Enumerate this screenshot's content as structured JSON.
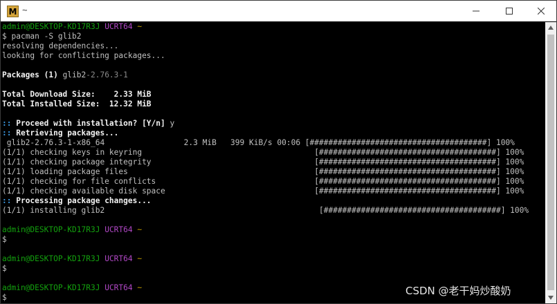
{
  "window": {
    "title": "~",
    "app_icon_letter": "M",
    "controls": [
      "minimize-icon",
      "maximize-icon",
      "close-icon"
    ]
  },
  "prompt": {
    "user_host": "admin@DESKTOP-KD17R3J",
    "env": "UCRT64",
    "dir": "~",
    "symbol": "$"
  },
  "terminal": {
    "cmd": " pacman -S glib2",
    "resolving": "resolving dependencies...",
    "conflicts": "looking for conflicting packages...",
    "packages_label": "Packages (1) ",
    "packages_name": "glib2",
    "packages_version": "-2.76.3-1",
    "download_size": "Total Download Size:    2.33 MiB",
    "installed_size": "Total Installed Size:  12.32 MiB",
    "proceed_marker": "::",
    "proceed_text": " Proceed with installation? [Y/n] ",
    "proceed_answer": "y",
    "retrieving_marker": "::",
    "retrieving_text": " Retrieving packages...",
    "download_line": " glib2-2.76.3-1-x86_64                 2.3 MiB   399 KiB/s 00:06 [######################################] 100%",
    "check_lines": [
      "(1/1) checking keys in keyring                                     [######################################] 100%",
      "(1/1) checking package integrity                                   [######################################] 100%",
      "(1/1) loading package files                                        [######################################] 100%",
      "(1/1) checking for file conflicts                                  [######################################] 100%",
      "(1/1) checking available disk space                                [######################################] 100%"
    ],
    "processing_marker": "::",
    "processing_text": " Processing package changes...",
    "installing_line": "(1/1) installing glib2                                              [######################################] 100%"
  },
  "watermark": "CSDN @老干妈炒酸奶"
}
